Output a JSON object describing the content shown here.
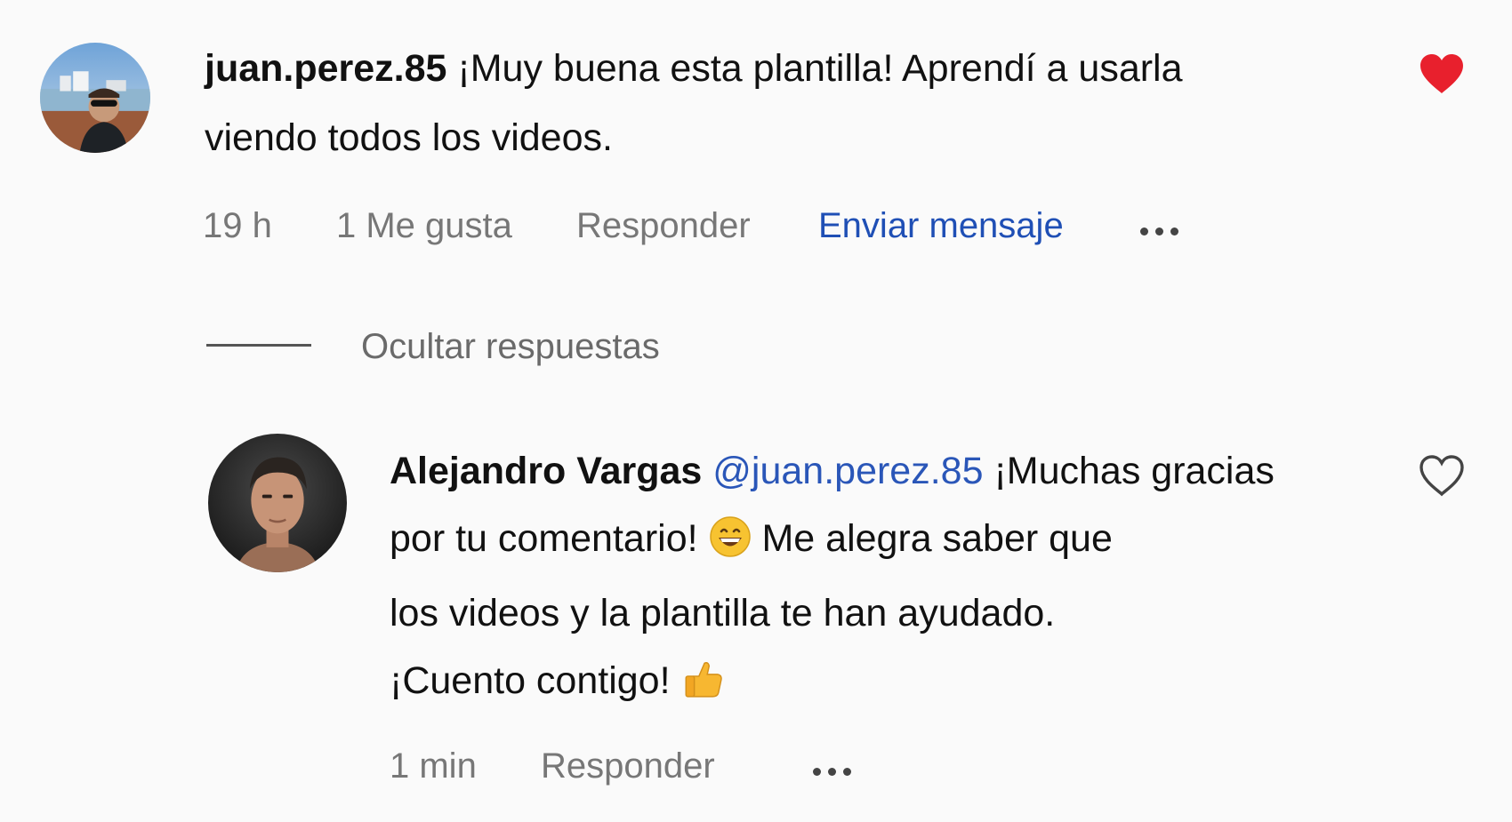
{
  "comment": {
    "username": "juan.perez.85",
    "text_line1": "¡Muy buena esta plantilla! Aprendí a usarla",
    "text_line2": "viendo todos los videos.",
    "time": "19 h",
    "likes": "1 Me gusta",
    "reply_label": "Responder",
    "send_message_label": "Enviar mensaje",
    "liked": true,
    "like_color": "#e8202d",
    "avatar_icon": "user-avatar-photo"
  },
  "replies_toggle": {
    "label": "Ocultar respuestas"
  },
  "reply": {
    "username": "Alejandro Vargas",
    "mention": "@juan.perez.85",
    "text_seg1": "¡Muchas gracias",
    "text_seg2": "por tu comentario!",
    "text_seg3": "Me alegra saber que",
    "text_line3": "los videos y la plantilla te han ayudado.",
    "text_line4": "¡Cuento contigo!",
    "emoji1": "grinning-face-emoji",
    "emoji2": "thumbs-up-emoji",
    "time": "1 min",
    "reply_label": "Responder",
    "liked": false,
    "mention_color": "#2a56b8",
    "avatar_icon": "user-avatar-photo"
  },
  "colors": {
    "link_blue": "#1f4fb5",
    "muted": "#777777",
    "heart_red": "#e8202d",
    "background": "#fafafa"
  }
}
